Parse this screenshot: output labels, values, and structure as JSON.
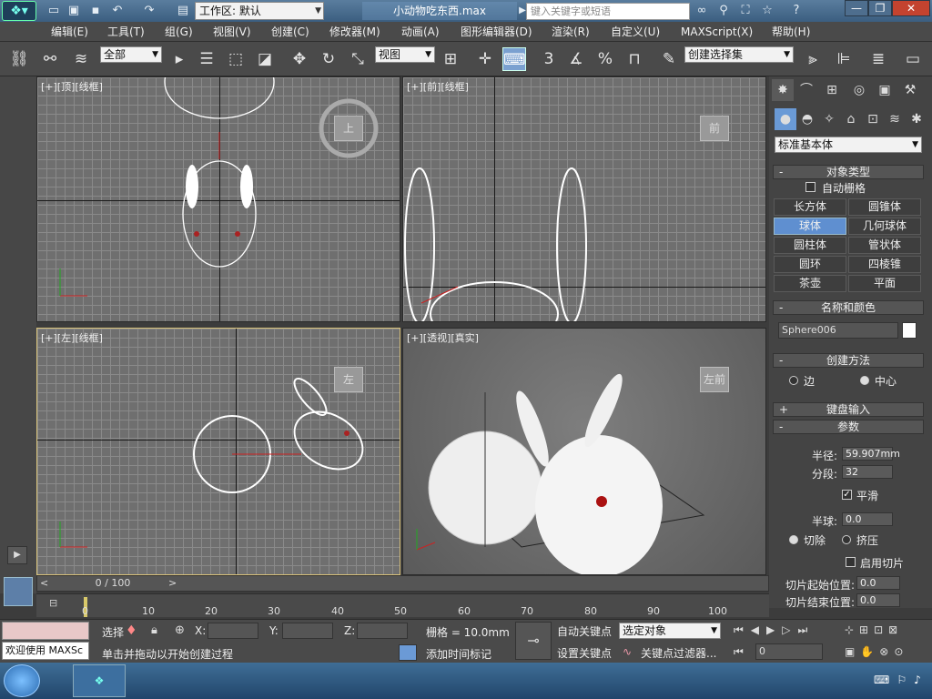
{
  "titlebar": {
    "workspace_label": "工作区: 默认",
    "filename": "小动物吃东西.max",
    "search_placeholder": "键入关键字或短语"
  },
  "menu": [
    "编辑(E)",
    "工具(T)",
    "组(G)",
    "视图(V)",
    "创建(C)",
    "修改器(M)",
    "动画(A)",
    "图形编辑器(D)",
    "渲染(R)",
    "自定义(U)",
    "MAXScript(X)",
    "帮助(H)"
  ],
  "toolbar": {
    "filter_select": "全部",
    "ref_coord_select": "视图",
    "named_selection_placeholder": "创建选择集",
    "spinner_snap_label": "3",
    "percent_label": "%"
  },
  "viewports": {
    "top": {
      "label": "[+][顶][线框]",
      "cube_label": "上"
    },
    "front": {
      "label": "[+][前][线框]",
      "cube_label": "前"
    },
    "left": {
      "label": "[+][左][线框]",
      "cube_label": "左"
    },
    "perspective": {
      "label": "[+][透视][真实]",
      "cube_label": "左前"
    }
  },
  "command_panel": {
    "primitive_dropdown": "标准基本体",
    "object_type_header": "对象类型",
    "autogrid_label": "自动栅格",
    "objects": [
      "长方体",
      "圆锥体",
      "球体",
      "几何球体",
      "圆柱体",
      "管状体",
      "圆环",
      "四棱锥",
      "茶壶",
      "平面"
    ],
    "selected_object": "球体",
    "name_color_header": "名称和颜色",
    "object_name": "Sphere006",
    "creation_method_header": "创建方法",
    "creation_edge": "边",
    "creation_center": "中心",
    "keyboard_entry_header": "键盘输入",
    "params_header": "参数",
    "radius_label": "半径:",
    "radius_value": "59.907mm",
    "segments_label": "分段:",
    "segments_value": "32",
    "smooth_label": "平滑",
    "hemisphere_label": "半球:",
    "hemisphere_value": "0.0",
    "chop_label": "切除",
    "squash_label": "挤压",
    "slice_on_label": "启用切片",
    "slice_from_label": "切片起始位置:",
    "slice_from_value": "0.0",
    "slice_to_label": "切片结束位置:",
    "slice_to_value": "0.0"
  },
  "timeline": {
    "frame_display": "0 / 100",
    "ticks": [
      "0",
      "10",
      "20",
      "30",
      "40",
      "50",
      "60",
      "70",
      "80",
      "90",
      "100"
    ]
  },
  "status": {
    "welcome": "欢迎使用 MAXSc",
    "select_label": "选择",
    "x_label": "X:",
    "y_label": "Y:",
    "z_label": "Z:",
    "grid_label": "栅格 = 10.0mm",
    "prompt": "单击并拖动以开始创建过程",
    "add_time_tag": "添加时间标记",
    "auto_key": "自动关键点",
    "set_key": "设置关键点",
    "key_mode_select": "选定对象",
    "key_filters": "关键点过滤器...",
    "current_frame": "0"
  },
  "colors": {
    "accent": "#5f8fd0",
    "active_viewport_border": "#d8c27a",
    "object_color": "#ffffff"
  }
}
